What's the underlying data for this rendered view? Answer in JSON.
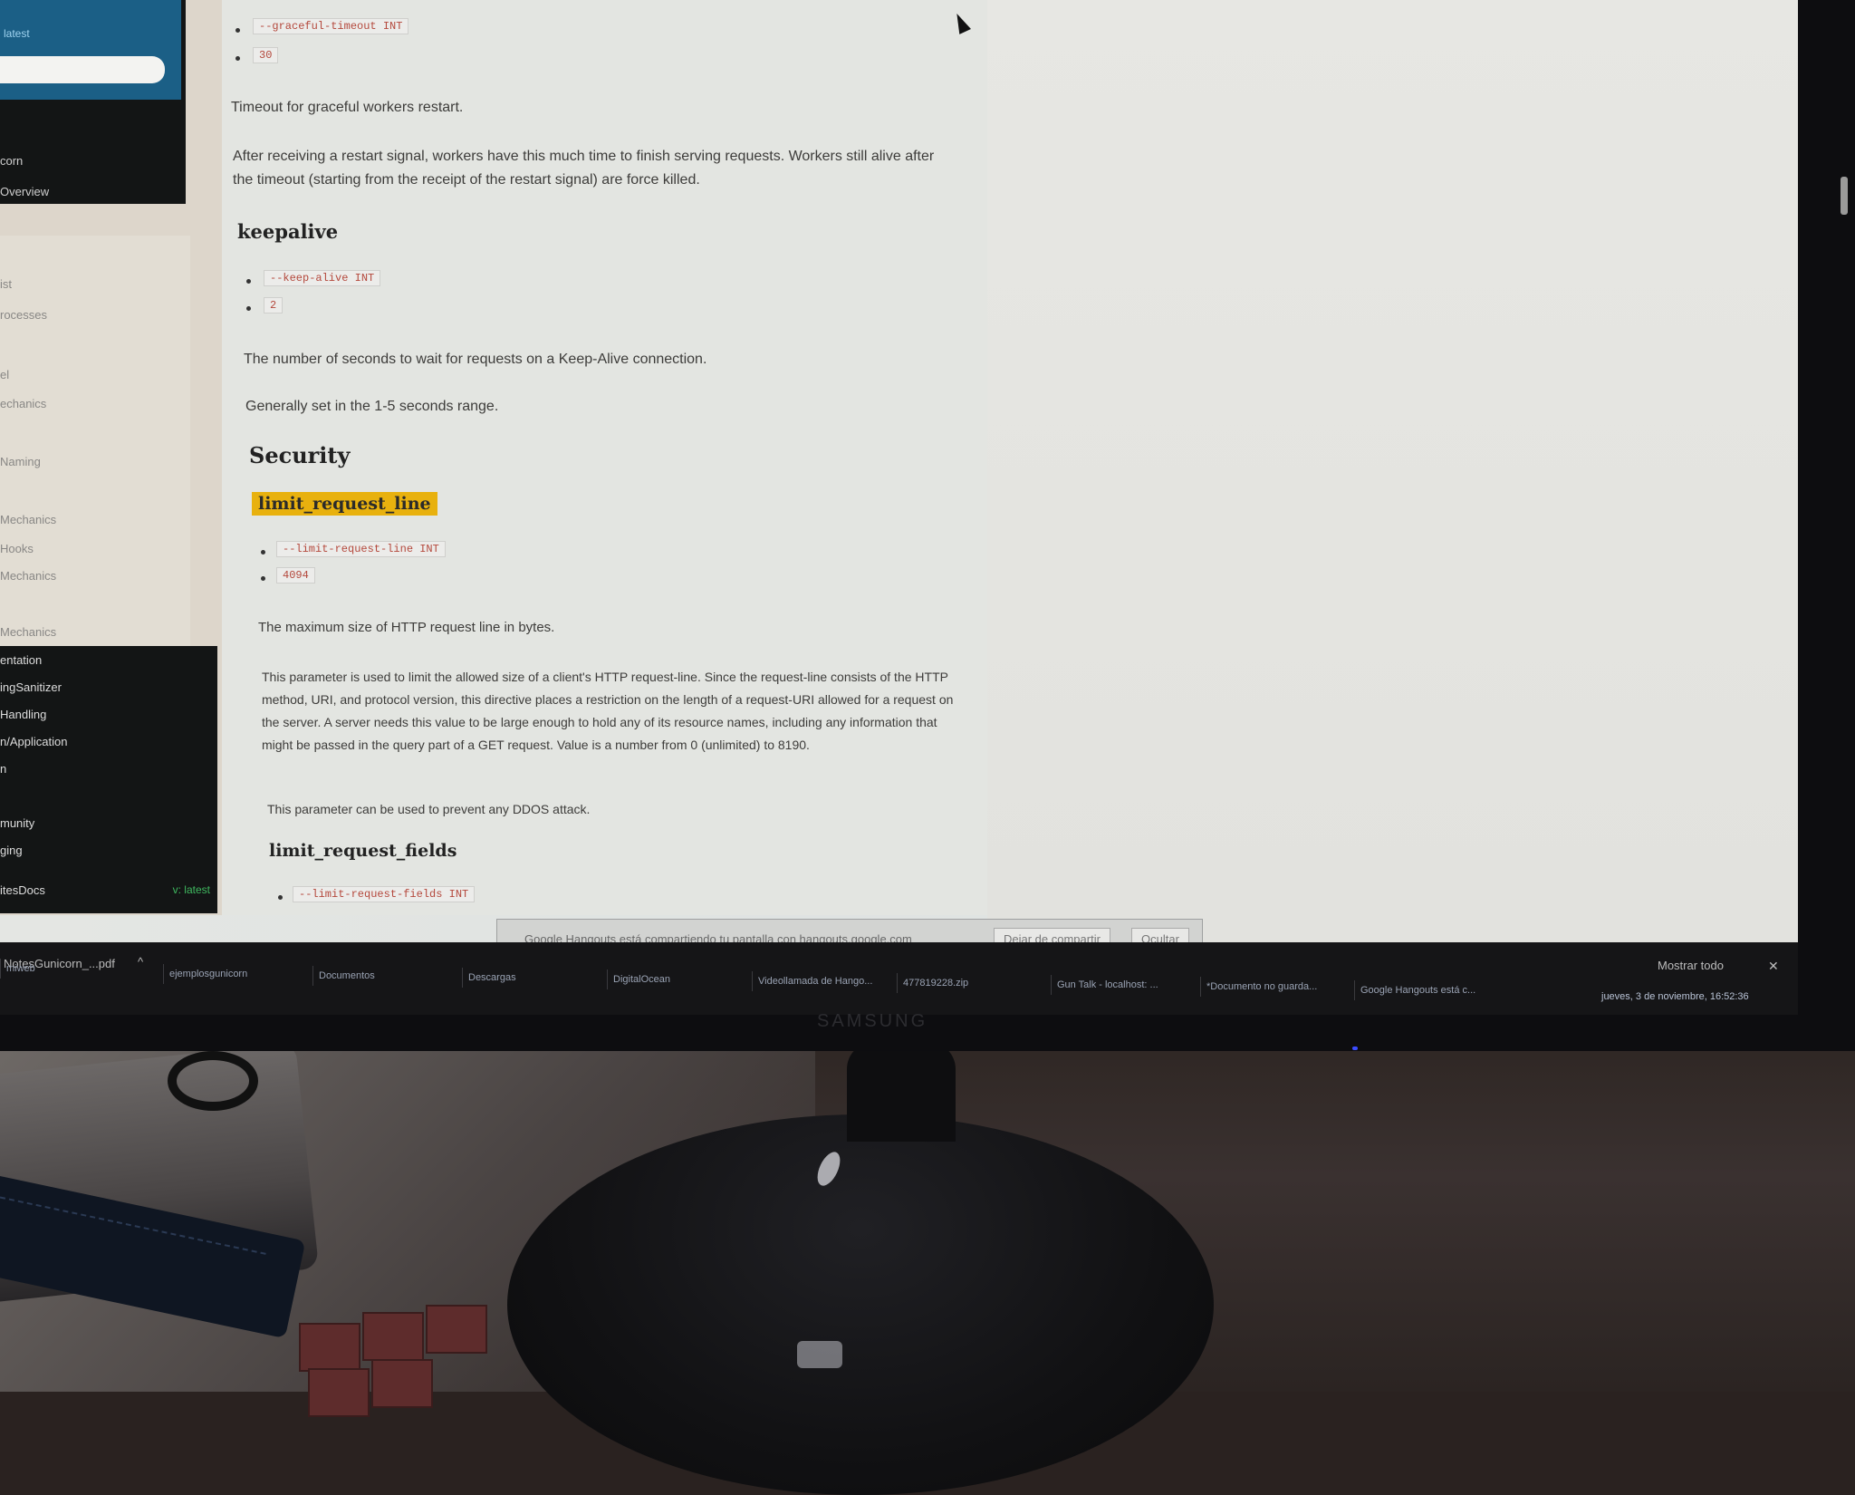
{
  "sidebar": {
    "brand_link": "latest",
    "dark_links": [
      "corn",
      "Overview"
    ],
    "light_items": [
      "ist",
      "rocesses",
      "el",
      "echanics",
      "Naming",
      "Mechanics",
      "Hooks",
      "Mechanics",
      "Mechanics"
    ],
    "dark_items": [
      "entation",
      "ingSanitizer",
      "Handling",
      "n/Application",
      "n",
      "munity",
      "ging",
      "itesDocs"
    ],
    "version_badge": "v: latest"
  },
  "content": {
    "graceful_flag": "--graceful-timeout INT",
    "graceful_default": "30",
    "graceful_desc": "Timeout for graceful workers restart.",
    "graceful_detail": "After receiving a restart signal, workers have this much time to finish serving requests. Workers still alive after the timeout (starting from the receipt of the restart signal) are force killed.",
    "keepalive_title": "keepalive",
    "keepalive_flag": "--keep-alive INT",
    "keepalive_default": "2",
    "keepalive_desc": "The number of seconds to wait for requests on a Keep-Alive connection.",
    "keepalive_note": "Generally set in the 1-5 seconds range.",
    "security_title": "Security",
    "limit_line_title": "limit_request_line",
    "limit_line_flag": "--limit-request-line INT",
    "limit_line_default": "4094",
    "limit_line_desc": "The maximum size of HTTP request line in bytes.",
    "limit_line_detail": "This parameter is used to limit the allowed size of a client's HTTP request-line. Since the request-line consists of the HTTP method, URI, and protocol version, this directive places a restriction on the length of a request-URI allowed for a request on the server. A server needs this value to be large enough to hold any of its resource names, including any information that might be passed in the query part of a GET request. Value is a number from 0 (unlimited) to 8190.",
    "limit_line_ddos": "This parameter can be used to prevent any DDOS attack.",
    "limit_fields_title": "limit_request_fields",
    "limit_fields_flag": "--limit-request-fields INT"
  },
  "share_bar": {
    "message": "Google Hangouts está compartiendo tu pantalla con hangouts.google.com",
    "stop_label": "Dejar de compartir",
    "hide_label": "Ocultar"
  },
  "taskbar": {
    "group_label": "NotesGunicorn_...pdf",
    "show_all": "Mostrar todo",
    "close": "✕",
    "tasks": [
      "miweb",
      "ejemplosgunicorn",
      "Documentos",
      "Descargas",
      "DigitalOcean",
      "Videollamada de Hango...",
      "477819228.zip",
      "Gun Talk - localhost: ...",
      "*Documento no guarda...",
      "Google Hangouts está c..."
    ],
    "tray_text": "jueves, 3 de noviembre, 16:52:36"
  },
  "monitor": {
    "brand": "SAMSUNG"
  },
  "colors": {
    "highlight": "#e8b10e",
    "code_text": "#b4483c",
    "sidebar_blue": "#1b5f86"
  },
  "icons": [
    "mouse-cursor-icon",
    "chevron-up-icon",
    "close-icon"
  ]
}
